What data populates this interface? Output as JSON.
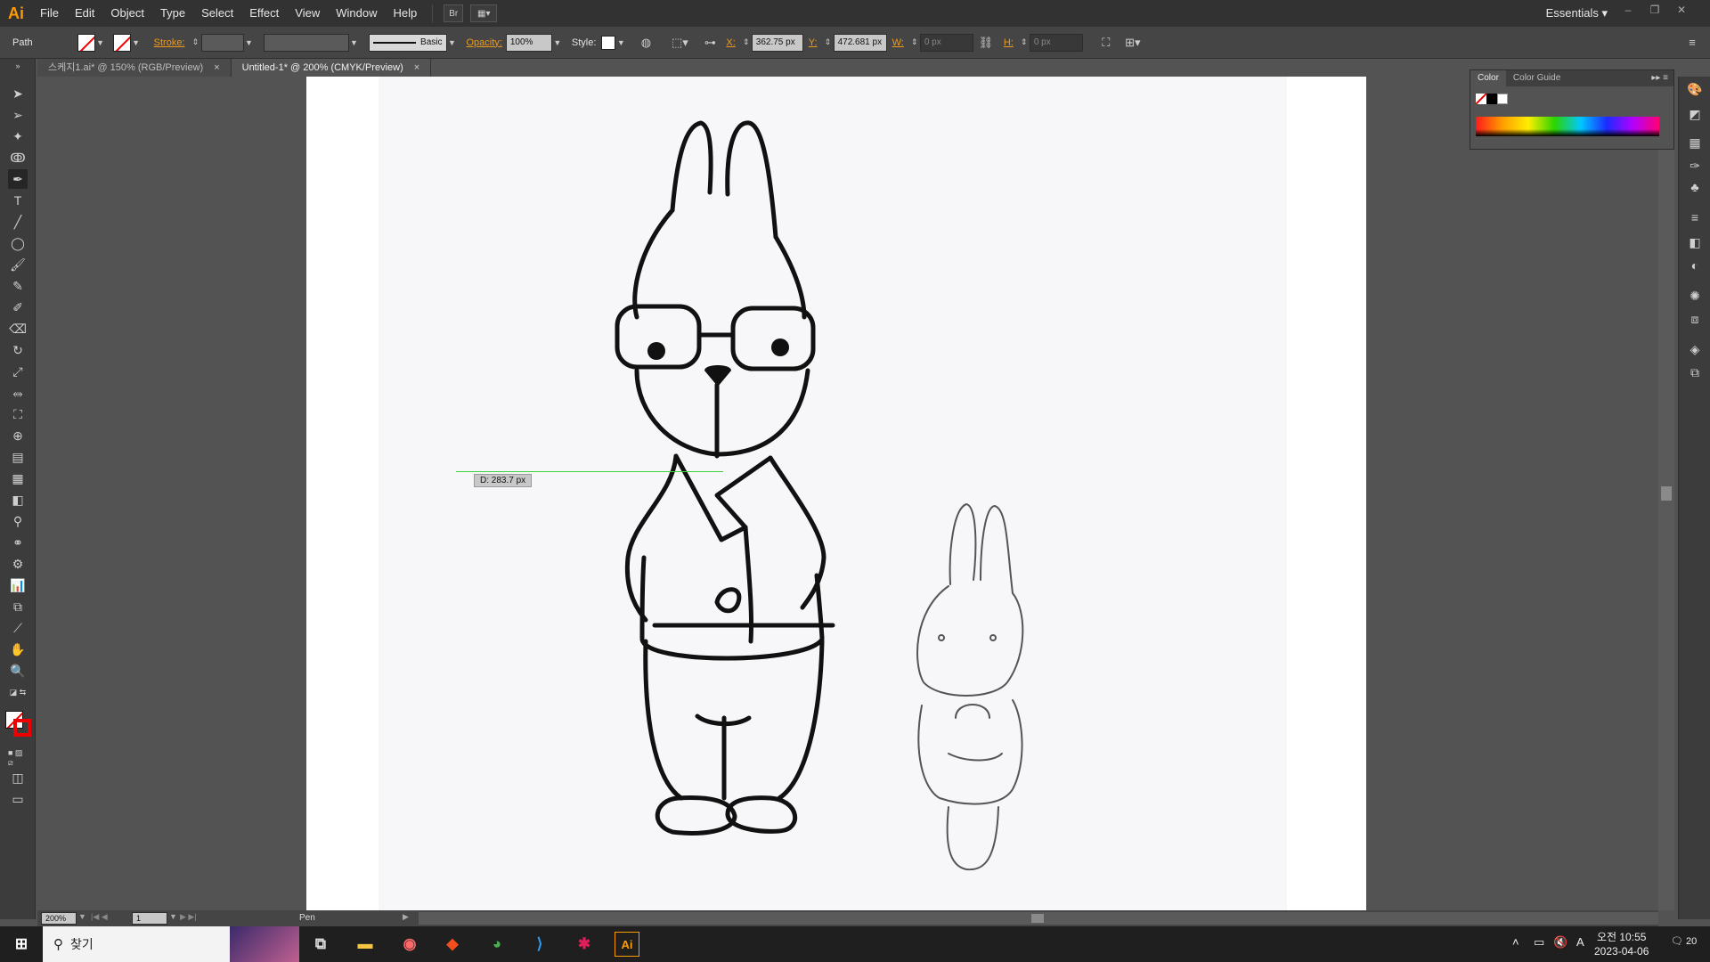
{
  "app": {
    "logo": "Ai"
  },
  "menu": [
    "File",
    "Edit",
    "Object",
    "Type",
    "Select",
    "Effect",
    "View",
    "Window",
    "Help"
  ],
  "workspace": "Essentials",
  "control": {
    "selection_label": "Path",
    "stroke_label": "Stroke:",
    "brush_label": "Basic",
    "opacity_label": "Opacity:",
    "opacity_value": "100%",
    "style_label": "Style:",
    "x_label": "X:",
    "x_value": "362.75 px",
    "y_label": "Y:",
    "y_value": "472.681 px",
    "w_label": "W:",
    "w_value": "0 px",
    "h_label": "H:",
    "h_value": "0 px"
  },
  "tabs": [
    {
      "label": "스케지1.ai* @ 150% (RGB/Preview)",
      "close": "×"
    },
    {
      "label": "Untitled-1* @ 200% (CMYK/Preview)",
      "close": "×"
    }
  ],
  "canvas": {
    "measure_label": "D: 283.7 px"
  },
  "color_panel": {
    "tabs": [
      "Color",
      "Color Guide"
    ]
  },
  "status": {
    "zoom": "200%",
    "artboard": "1",
    "tool": "Pen"
  },
  "taskbar": {
    "search_placeholder": "찾기",
    "time": "오전 10:55",
    "date": "2023-04-06",
    "ime": "A",
    "notifications": "20"
  },
  "colors": {
    "accent": "#ff9a00",
    "active_tab": "#535353",
    "measure_line": "#3cd23c"
  }
}
